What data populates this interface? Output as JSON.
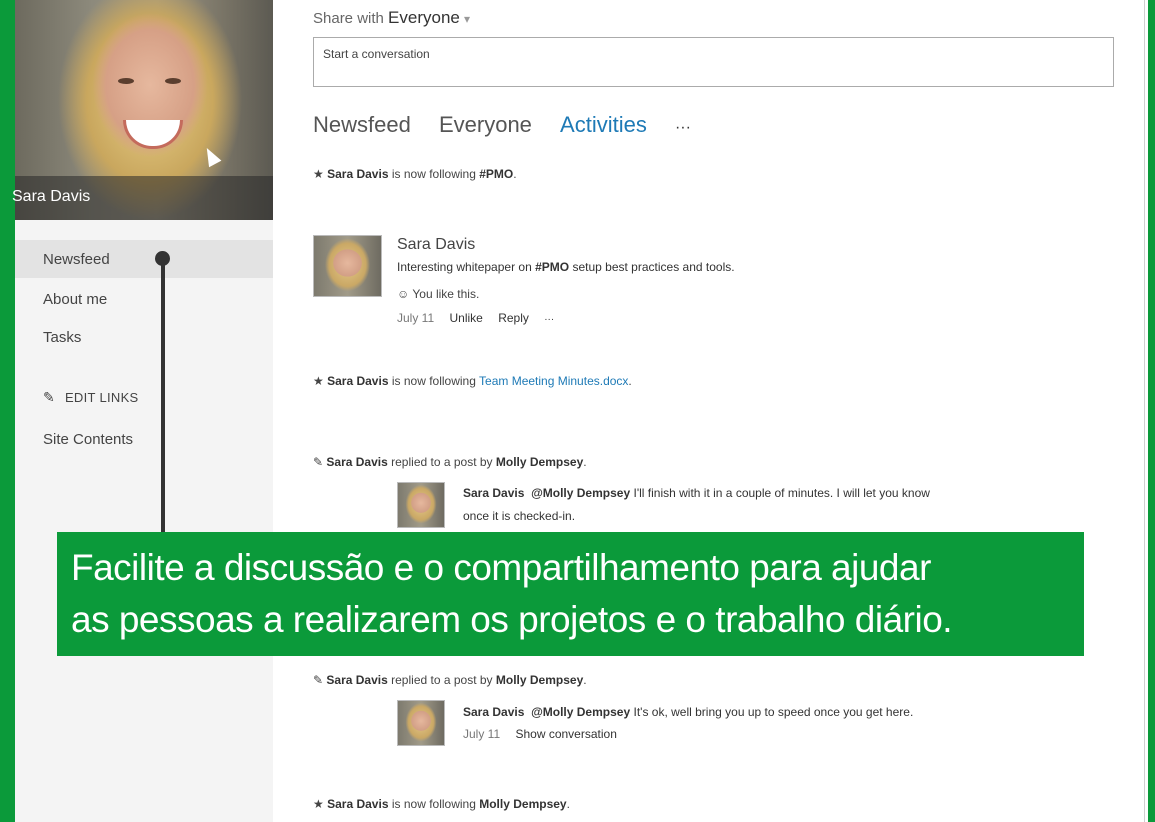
{
  "profile": {
    "name": "Sara Davis"
  },
  "nav": {
    "items": [
      "Newsfeed",
      "About me",
      "Tasks"
    ],
    "edit_links": "EDIT LINKS",
    "site_contents": "Site Contents"
  },
  "share": {
    "prefix": "Share with",
    "audience": "Everyone",
    "dropdown_glyph": "▾"
  },
  "composer": {
    "placeholder": "Start a conversation"
  },
  "tabs": [
    "Newsfeed",
    "Everyone",
    "Activities",
    "···"
  ],
  "feed": {
    "item1": {
      "icon": "★",
      "user": "Sara Davis",
      "text": "is now following",
      "target": "#PMO",
      "suffix": "."
    },
    "post": {
      "author": "Sara Davis",
      "text_before": "Interesting whitepaper on",
      "text_tag": "#PMO",
      "text_after": "setup best practices and tools.",
      "like_text": "☺ You like this.",
      "date": "July 11",
      "action_unlike": "Unlike",
      "action_reply": "Reply",
      "action_more": "···"
    },
    "item3": {
      "icon": "★",
      "user": "Sara Davis",
      "text": "is now following",
      "target": "Team Meeting Minutes.docx",
      "suffix": "."
    },
    "item4": {
      "icon": "✎",
      "user": "Sara Davis",
      "text": "replied to a post by",
      "target": "Molly Dempsey",
      "suffix": "."
    },
    "reply1": {
      "author": "Sara Davis",
      "mention": "@Molly Dempsey",
      "line1": "I'll finish with it in a couple of minutes. I will let you know",
      "line2": "once it is checked-in."
    },
    "item5": {
      "icon": "✎",
      "user": "Sara Davis",
      "text": "replied to a post by",
      "target": "Molly Dempsey",
      "suffix": "."
    },
    "reply2": {
      "author": "Sara Davis",
      "mention": "@Molly Dempsey",
      "line1": "It's ok, well bring you up to speed once you get here.",
      "date": "July 11",
      "action": "Show conversation"
    },
    "item6": {
      "icon": "★",
      "user": "Sara Davis",
      "text": "is now following",
      "target": "Molly Dempsey",
      "suffix": "."
    }
  },
  "banner": {
    "line1": "Facilite a discussão e o compartilhamento para ajudar",
    "line2": "as pessoas a realizarem os projetos e o trabalho diário."
  },
  "colors": {
    "accent_green": "#0b9a3a",
    "link_blue": "#1e7ab6"
  }
}
